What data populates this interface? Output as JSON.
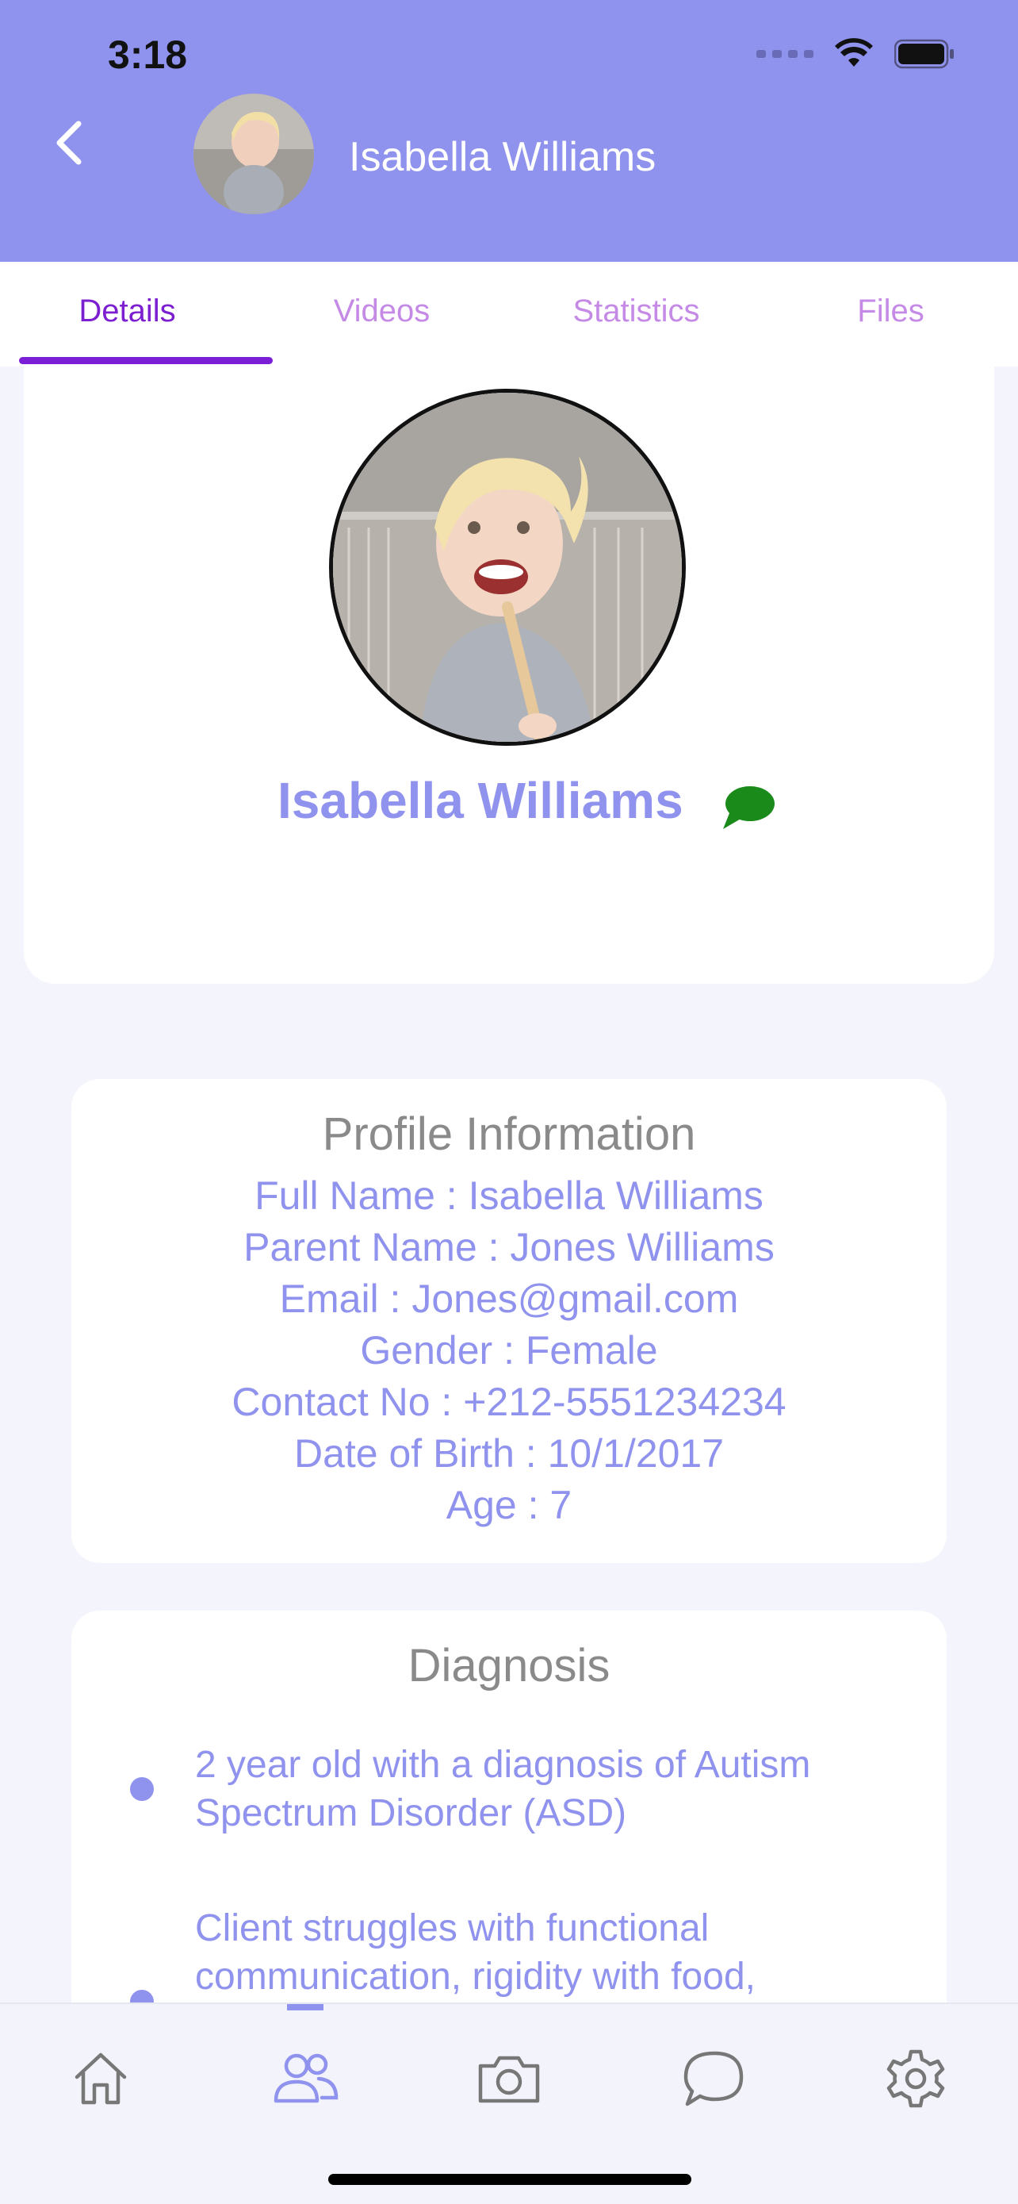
{
  "status_bar": {
    "time": "3:18"
  },
  "header": {
    "name": "Isabella Williams"
  },
  "tabs": [
    {
      "label": "Details",
      "active": true
    },
    {
      "label": "Videos",
      "active": false
    },
    {
      "label": "Statistics",
      "active": false
    },
    {
      "label": "Files",
      "active": false
    }
  ],
  "profile": {
    "name": "Isabella Williams"
  },
  "profile_info": {
    "title": "Profile Information",
    "lines": [
      "Full Name : Isabella Williams",
      "Parent Name : Jones Williams",
      "Email : Jones@gmail.com",
      "Gender : Female",
      "Contact No : +212-5551234234",
      "Date of Birth : 10/1/2017",
      "Age : 7"
    ]
  },
  "diagnosis": {
    "title": "Diagnosis",
    "items": [
      "2 year old with a diagnosis of Autism Spectrum Disorder (ASD)",
      "Client struggles with functional communication, rigidity with food,"
    ]
  },
  "bottom_nav": {
    "items": [
      {
        "icon": "home-icon",
        "active": false
      },
      {
        "icon": "people-icon",
        "active": true
      },
      {
        "icon": "camera-icon",
        "active": false
      },
      {
        "icon": "chat-icon",
        "active": false
      },
      {
        "icon": "gear-icon",
        "active": false
      }
    ]
  },
  "colors": {
    "accent": "#9093ee",
    "active_tab": "#7c1fd0",
    "inactive_tab": "#c48ae6",
    "chat_badge": "#1a8a1a"
  }
}
